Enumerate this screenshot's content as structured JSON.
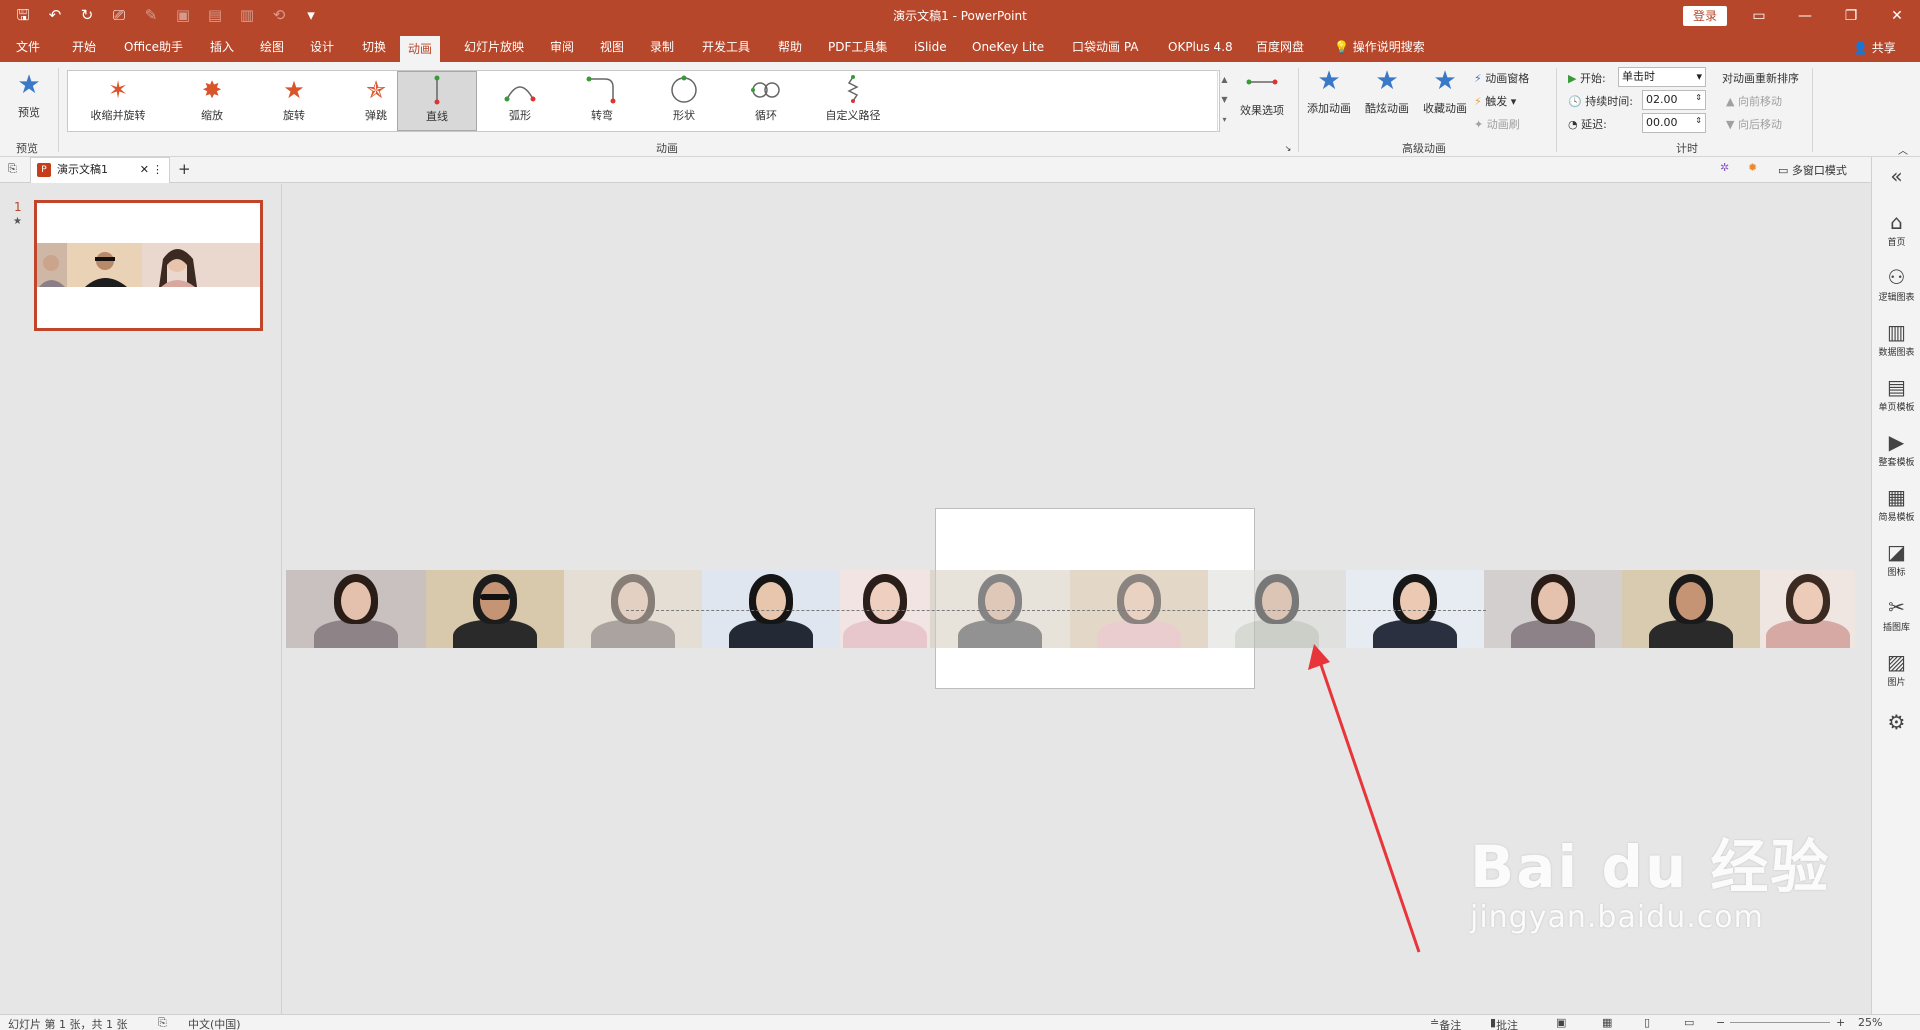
{
  "window": {
    "title": "演示文稿1  -  PowerPoint",
    "login_label": "登录",
    "share_label": "共享"
  },
  "menu": {
    "tabs": [
      "文件",
      "开始",
      "Office助手",
      "插入",
      "绘图",
      "设计",
      "切换",
      "动画",
      "幻灯片放映",
      "审阅",
      "视图",
      "录制",
      "开发工具",
      "帮助",
      "PDF工具集",
      "iSlide",
      "OneKey Lite",
      "口袋动画 PA",
      "OKPlus 4.8",
      "百度网盘"
    ],
    "active_tab": "动画",
    "search_label": "操作说明搜索"
  },
  "ribbon": {
    "preview": {
      "label": "预览",
      "group": "预览"
    },
    "animations": {
      "group": "动画",
      "items": [
        {
          "label": "收缩并旋转",
          "icon": "star-spin-icon"
        },
        {
          "label": "缩放",
          "icon": "star-zoom-icon"
        },
        {
          "label": "旋转",
          "icon": "star-rotate-icon"
        },
        {
          "label": "弹跳",
          "icon": "star-bounce-icon"
        },
        {
          "label": "直线",
          "icon": "line-path-icon"
        },
        {
          "label": "弧形",
          "icon": "arc-path-icon"
        },
        {
          "label": "转弯",
          "icon": "turn-path-icon"
        },
        {
          "label": "形状",
          "icon": "shape-path-icon"
        },
        {
          "label": "循环",
          "icon": "loop-path-icon"
        },
        {
          "label": "自定义路径",
          "icon": "custom-path-icon"
        }
      ],
      "selected": "直线",
      "effect_options": "效果选项"
    },
    "advanced": {
      "group": "高级动画",
      "add": "添加动画",
      "cool": "酷炫动画",
      "favorite": "收藏动画",
      "pane": "动画窗格",
      "trigger": "触发",
      "painter": "动画刷"
    },
    "timing": {
      "group": "计时",
      "start_label": "开始:",
      "start_value": "单击时",
      "duration_label": "持续时间:",
      "duration_value": "02.00",
      "delay_label": "延迟:",
      "delay_value": "00.00",
      "reorder": "对动画重新排序",
      "move_earlier": "向前移动",
      "move_later": "向后移动"
    }
  },
  "doc_tabs": {
    "current": "演示文稿1",
    "multiwindow": "多窗口模式"
  },
  "thumbnails": {
    "slide_number": "1",
    "animation_marker": "★"
  },
  "side_panel": [
    {
      "label": "首页",
      "icon": "home-icon"
    },
    {
      "label": "逻辑图表",
      "icon": "logic-chart-icon"
    },
    {
      "label": "数据图表",
      "icon": "data-chart-icon"
    },
    {
      "label": "单页模板",
      "icon": "single-page-icon"
    },
    {
      "label": "整套模板",
      "icon": "full-template-icon"
    },
    {
      "label": "简易模板",
      "icon": "simple-template-icon"
    },
    {
      "label": "图标",
      "icon": "icon-library-icon"
    },
    {
      "label": "插图库",
      "icon": "illustration-icon"
    },
    {
      "label": "图片",
      "icon": "picture-icon"
    }
  ],
  "status": {
    "slide_info": "幻灯片 第 1 张，共 1 张",
    "language": "中文(中国)",
    "notes": "备注",
    "comments": "批注",
    "zoom": "25%"
  },
  "watermark": {
    "main": "Bai du 经验",
    "sub": "jingyan.baidu.com"
  },
  "colors": {
    "brand": "#b7472a",
    "ribbon_bg": "#f3f3f3",
    "canvas_bg": "#e6e6e6",
    "annotation_arrow": "#e8353a"
  }
}
